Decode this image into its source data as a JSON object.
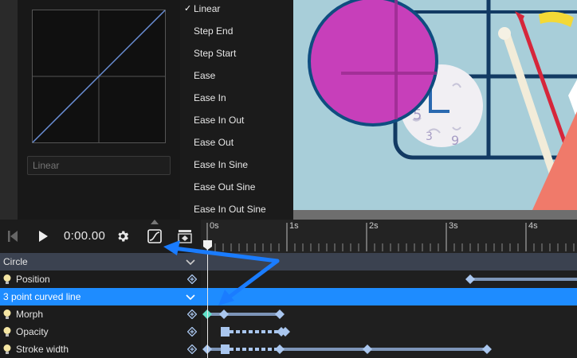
{
  "easing": {
    "input_placeholder": "Linear",
    "curve_color": "#6b8fd6",
    "menu": [
      {
        "label": "Linear",
        "checked": true
      },
      {
        "label": "Step End",
        "checked": false
      },
      {
        "label": "Step Start",
        "checked": false
      },
      {
        "label": "Ease",
        "checked": false
      },
      {
        "label": "Ease In",
        "checked": false
      },
      {
        "label": "Ease In Out",
        "checked": false
      },
      {
        "label": "Ease Out",
        "checked": false
      },
      {
        "label": "Ease In Sine",
        "checked": false
      },
      {
        "label": "Ease Out Sine",
        "checked": false
      },
      {
        "label": "Ease In Out Sine",
        "checked": false
      }
    ],
    "check_mark": "✓"
  },
  "toolbar": {
    "time": "0:00.00",
    "icons": [
      "skip-to-start-icon",
      "play-icon",
      "gear-icon",
      "easing-curve-icon",
      "keyframe-interpolation-icon"
    ]
  },
  "ruler": {
    "labels": [
      "0s",
      "1s",
      "2s",
      "3s",
      "4s"
    ]
  },
  "tracks": {
    "group_label": "Circle",
    "selected_label": "3 point curved line",
    "properties": [
      {
        "label": "Position",
        "icon": "lightbulb-icon"
      },
      {
        "label": "Morph",
        "icon": "lightbulb-icon"
      },
      {
        "label": "Opacity",
        "icon": "lightbulb-icon"
      },
      {
        "label": "Stroke width",
        "icon": "lightbulb-icon"
      }
    ]
  },
  "colors": {
    "accent": "#1e90ff",
    "keyframe": "#a9c6ee",
    "keyframe_active": "#5fe0c8",
    "group_row": "#3b4250",
    "selected_row": "#1e8cff"
  }
}
